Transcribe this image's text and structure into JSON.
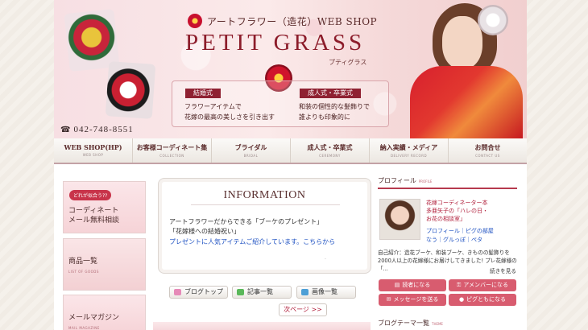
{
  "header": {
    "shop_label": "アートフラワー（造花）WEB SHOP",
    "brand": "PETIT GRASS",
    "brand_kana": "プティグラス",
    "promo_left_tag": "結婚式",
    "promo_left_text_1": "フラワーアイテムで",
    "promo_left_text_2": "花嫁の最高の美しさを引き出す",
    "promo_right_tag": "成人式・卒業式",
    "promo_right_text_1": "和装の個性的な髪飾りで",
    "promo_right_text_2": "誰よりも印象的に",
    "phone": "042-748-8551"
  },
  "nav": {
    "items": [
      {
        "label": "WEB SHOP(HP)",
        "sub": "WEB SHOP"
      },
      {
        "label": "お客様コーディネート集",
        "sub": "COLLECTION"
      },
      {
        "label": "ブライダル",
        "sub": "BRIDAL"
      },
      {
        "label": "成人式・卒業式",
        "sub": "CEREMONY"
      },
      {
        "label": "納入実績・メディア",
        "sub": "DELIVERY RECORD"
      },
      {
        "label": "お問合せ",
        "sub": "CONTACT US"
      }
    ]
  },
  "left_banners": {
    "consult_badge": "どれが似合う??",
    "consult_line_1": "コーディネート",
    "consult_line_2": "メール無料相談",
    "products_title": "商品一覧",
    "products_sub": "LIST OF GOODS",
    "mail_title": "メールマガジン",
    "mail_sub": "MAIL MAGAZINE"
  },
  "information": {
    "title": "INFORMATION",
    "line_1": "アートフラワーだからできる「ブーケのプレゼント」",
    "line_2": "「花嫁様への結婚祝い」",
    "link": "プレゼントに人気アイテムご紹介しています。こちらから",
    "dot": "."
  },
  "blog_nav": {
    "top": "ブログトップ",
    "articles": "記事一覧",
    "images": "画像一覧",
    "next": "次ページ >>"
  },
  "profile": {
    "heading": "プロフィール",
    "heading_sub": "PROFILE",
    "name_line_1": "花嫁コーディネーター本",
    "name_line_2": "多亜矢子の「ハレの日・",
    "name_line_3": "お花の相談室」",
    "links_line_1": "プロフィール｜ピグの部屋",
    "links_line_2": "なう｜グルっぽ｜ペタ",
    "intro": "自己紹介：造花ブーケ、和装ブーケ、きものの髪飾りを2000人以上の花嫁様にお届けしてきました! プレ花嫁様の「...",
    "more": "続きを見る",
    "btn_reader": "読者になる",
    "btn_member": "アメンバーになる",
    "btn_message": "メッセージを送る",
    "btn_friend": "ピグともになる"
  },
  "blog_theme": {
    "heading": "ブログテーマ一覧",
    "heading_sub": "THEME"
  },
  "icons": {
    "phone": "phone-icon",
    "top": "home-icon",
    "articles": "list-icon",
    "images": "image-icon",
    "reader": "book-icon",
    "member": "key-icon",
    "message": "mail-icon",
    "friend": "pig-icon"
  },
  "colors": {
    "accent": "#8f2132",
    "button": "#d85c6f",
    "link": "#1f52c2"
  }
}
